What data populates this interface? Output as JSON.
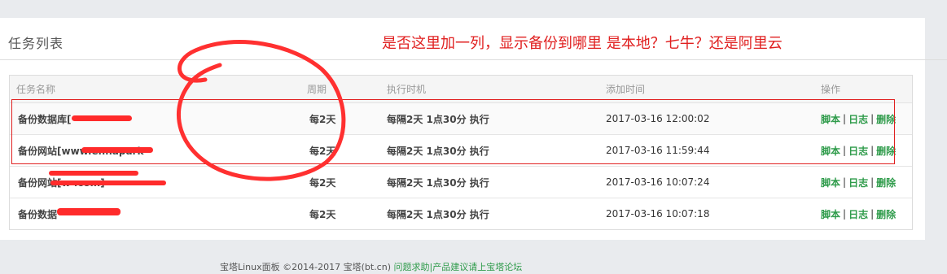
{
  "page": {
    "title": "任务列表",
    "annotation": "是否这里加一列，显示备份到哪里 是本地？七牛？还是阿里云"
  },
  "table": {
    "headers": [
      "任务名称",
      "周期",
      "执行时机",
      "添加时间",
      "操作"
    ],
    "rows": [
      {
        "name": "备份数据库[",
        "cycle": "每2天",
        "exec": "每隔2天 1点30分 执行",
        "time": "2017-03-16 12:00:02"
      },
      {
        "name": "备份网站[www.ennapark",
        "cycle": "每2天",
        "exec": "每隔2天 1点30分 执行",
        "time": "2017-03-16 11:59:44"
      },
      {
        "name": "备份网站[w           .com]",
        "cycle": "每2天",
        "exec": "每隔2天 1点30分 执行",
        "time": "2017-03-16 10:07:24"
      },
      {
        "name": "备份数据",
        "cycle": "每2天",
        "exec": "每隔2天 1点30分 执行",
        "time": "2017-03-16 10:07:18"
      }
    ],
    "ops": {
      "script": "脚本",
      "log": "日志",
      "delete": "删除",
      "sep": "|"
    }
  },
  "footer": {
    "text": "宝塔Linux面板 ©2014-2017 宝塔(bt.cn)",
    "link": "问题求助|产品建议请上宝塔论坛"
  },
  "colors": {
    "accent": "#2e9b4a",
    "annotation": "#e02020",
    "background": "#e9ebee"
  }
}
